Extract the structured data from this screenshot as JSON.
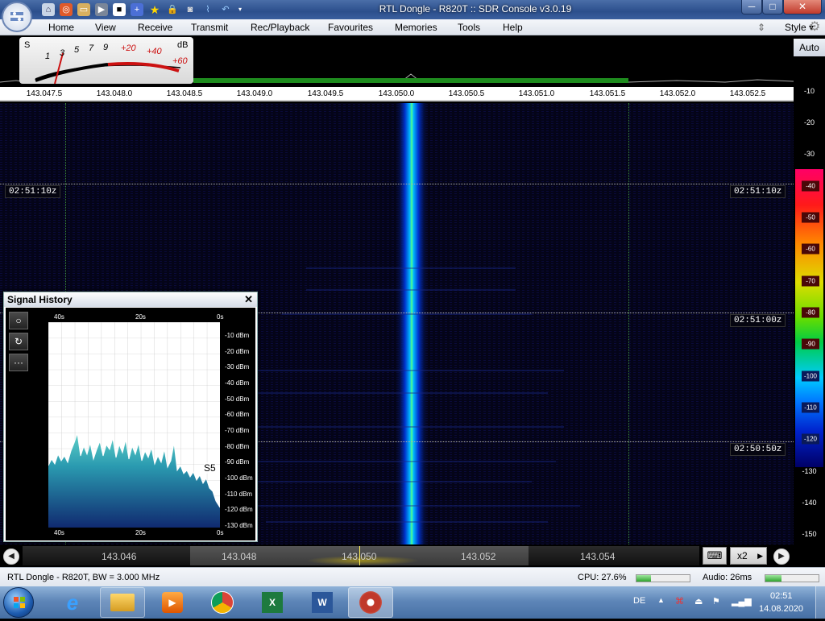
{
  "window": {
    "title": "RTL Dongle - R820T :: SDR Console v3.0.19",
    "minimize": "─",
    "maximize": "□",
    "close": "✕"
  },
  "menu": {
    "items": [
      "Home",
      "View",
      "Receive",
      "Transmit",
      "Rec/Playback",
      "Favourites",
      "Memories",
      "Tools",
      "Help"
    ],
    "style": "Style"
  },
  "smeter": {
    "s_label": "S",
    "db_label": "dB",
    "scale": [
      "1",
      "3",
      "5",
      "7",
      "9",
      "+20",
      "+40",
      "+60"
    ]
  },
  "freq_scale": [
    "143.047.5",
    "143.048.0",
    "143.048.5",
    "143.049.0",
    "143.049.5",
    "143.050.0",
    "143.050.5",
    "143.051.0",
    "143.051.5",
    "143.052.0",
    "143.052.5"
  ],
  "db_axis": {
    "auto": "Auto",
    "labels": [
      "-10",
      "-20",
      "-30",
      "-40",
      "-50",
      "-60",
      "-70",
      "-80",
      "-90",
      "-100",
      "-110",
      "-120",
      "-130",
      "-140",
      "-150"
    ]
  },
  "timestamps": [
    "02:51:10z",
    "02:51:00z",
    "02:50:50z"
  ],
  "signal_history": {
    "title": "Signal History",
    "close": "✕",
    "top_labels": [
      "40s",
      "20s",
      "0s"
    ],
    "bottom_labels": [
      "40s",
      "20s",
      "0s"
    ],
    "dbm_labels": [
      "-10 dBm",
      "-20 dBm",
      "-30 dBm",
      "-40 dBm",
      "-50 dBm",
      "-60 dBm",
      "-70 dBm",
      "-80 dBm",
      "-90 dBm",
      "-100 dBm",
      "-110 dBm",
      "-120 dBm",
      "-130 dBm"
    ],
    "s_reading": "S5",
    "buttons": [
      "○",
      "↻",
      "···"
    ]
  },
  "bottom_nav": {
    "freqs": [
      "143.046",
      "143.048",
      "143.050",
      "143.052",
      "143.054"
    ],
    "zoom": "x2",
    "keyboard": "⌨"
  },
  "status": {
    "left": "RTL Dongle - R820T, BW = 3.000 MHz",
    "cpu": "CPU: 27.6%",
    "cpu_level": 0.276,
    "audio": "Audio: 26ms",
    "audio_level": 0.3
  },
  "taskbar": {
    "lang": "DE",
    "time": "02:51",
    "date": "14.08.2020"
  }
}
